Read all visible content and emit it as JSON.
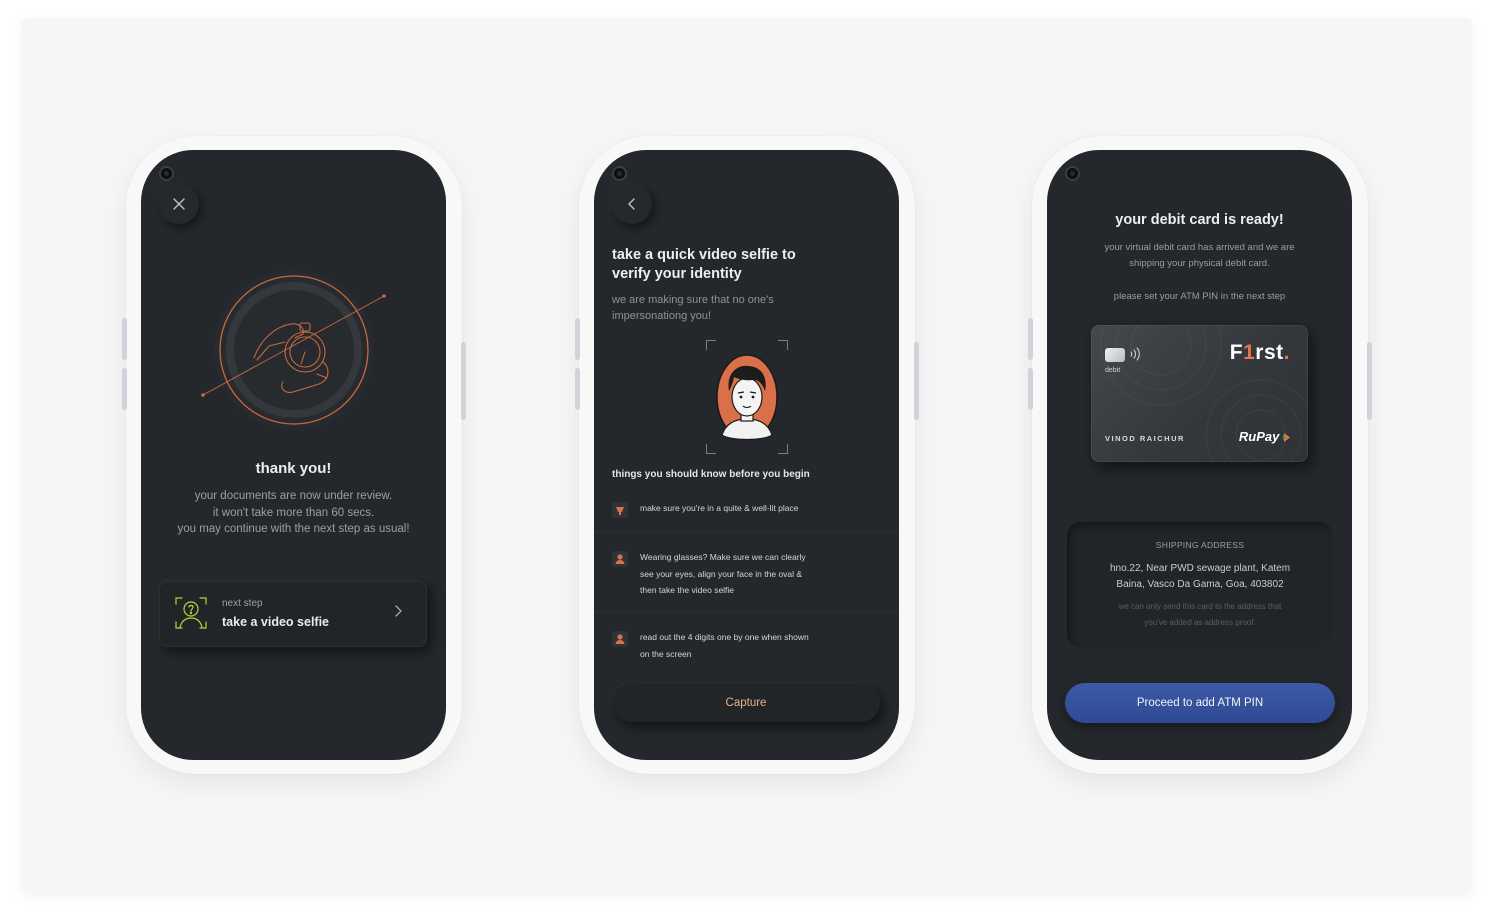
{
  "screen1": {
    "title": "thank you!",
    "lines": [
      "your documents are now under review.",
      "it won't take more than 60 secs.",
      "you may continue with the next step as usual!"
    ],
    "next_step_label": "next step",
    "next_step_title": "take a video selfie",
    "close_icon": "close-icon",
    "chevron_icon": "chevron-right-icon"
  },
  "screen2": {
    "title_line1": "take a quick video selfie to",
    "title_line2": "verify your identity",
    "subtitle_line1": "we are making sure that no one's",
    "subtitle_line2": "impersonationg you!",
    "section_title": "things you should know before you begin",
    "tips": [
      {
        "lines": [
          "make sure you're in a quite & well-lit place"
        ]
      },
      {
        "lines": [
          "Wearing glasses? Make sure we can clearly",
          "see your eyes, align your face in the oval &",
          "then take the video selfie"
        ]
      },
      {
        "lines": [
          "read out the 4 digits one by one when shown",
          "on the screen"
        ]
      }
    ],
    "capture_label": "Capture",
    "back_icon": "chevron-left-icon"
  },
  "screen3": {
    "title": "your debit card is ready!",
    "desc_line1": "your virtual debit card has arrived and we are",
    "desc_line2": "shipping your physical debit card.",
    "pin_note": "please set your ATM PIN in the next step",
    "card": {
      "type_label": "debit",
      "brand_pre": "F",
      "brand_one": "1",
      "brand_post": "rst",
      "brand_dot": ".",
      "holder": "VINOD RAICHUR",
      "network": "RuPay"
    },
    "address_heading": "SHIPPING ADDRESS",
    "address_line1": "hno.22, Near PWD sewage plant, Katem",
    "address_line2": "Baina, Vasco Da Gama, Goa, 403802",
    "address_note1": "we can only send this card to the address that",
    "address_note2": "you've added as address proof.",
    "proceed_label": "Proceed to add ATM PIN"
  },
  "colors": {
    "screen_bg": "#24272b",
    "accent_orange": "#e8764a",
    "accent_lime": "#b7d43a",
    "button_blue": "#3d5aa6"
  }
}
